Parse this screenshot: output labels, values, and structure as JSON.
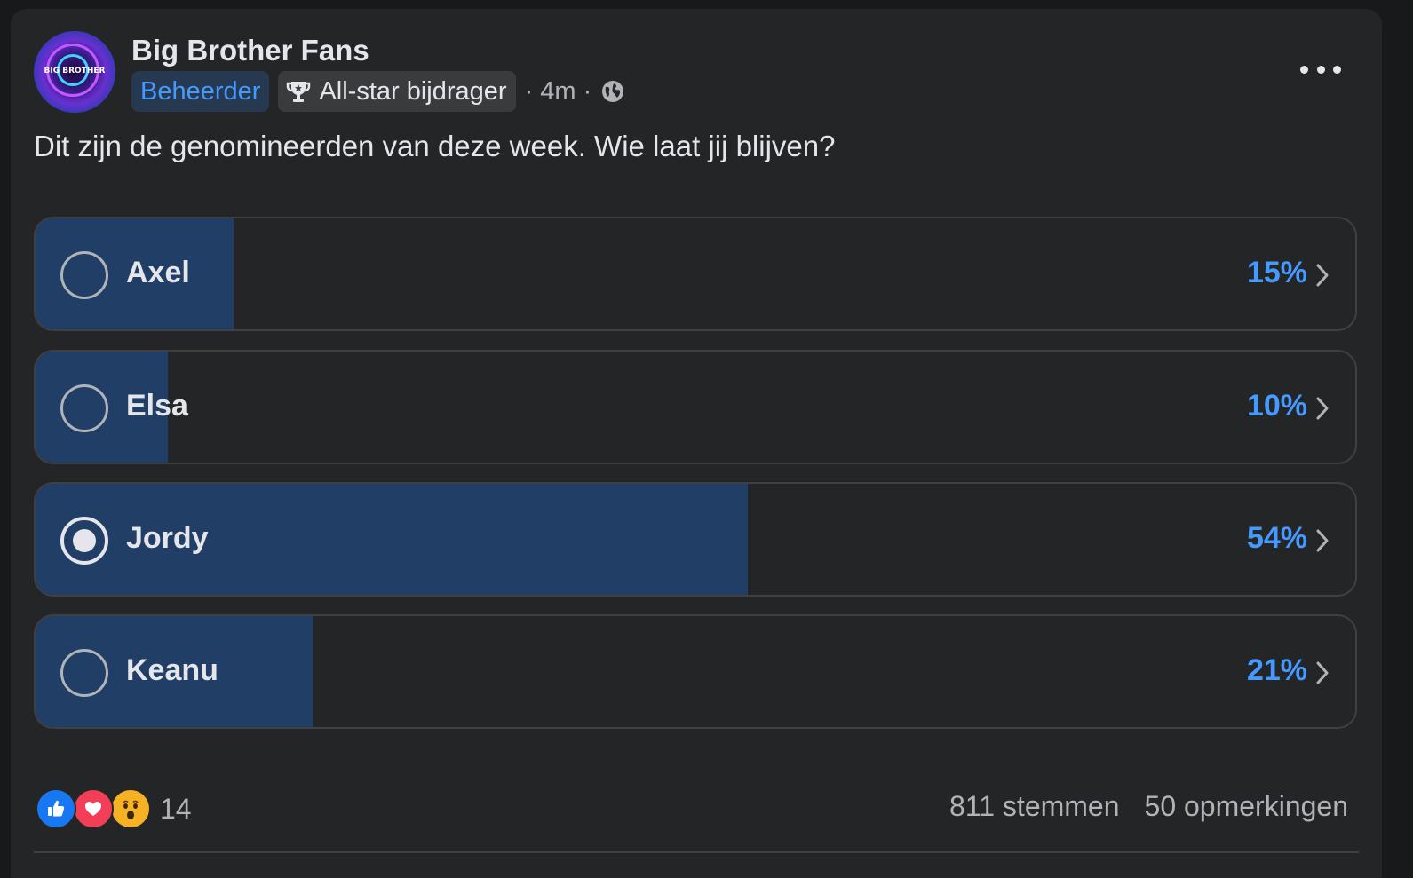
{
  "post": {
    "group_name": "Big Brother Fans",
    "avatar_logo_text": "BIG BROTHER",
    "badge_admin": "Beheerder",
    "badge_allstar": "All-star bijdrager",
    "time_text": "· 4m ·",
    "privacy_icon": "globe-icon",
    "more_icon": "more-options-icon",
    "text": "Dit zijn de genomineerden van deze week. Wie laat jij blijven?"
  },
  "poll": {
    "options": [
      {
        "label": "Axel",
        "percent_text": "15%",
        "fill_fraction": 0.15,
        "selected": false
      },
      {
        "label": "Elsa",
        "percent_text": "10%",
        "fill_fraction": 0.1,
        "selected": false
      },
      {
        "label": "Jordy",
        "percent_text": "54%",
        "fill_fraction": 0.54,
        "selected": true
      },
      {
        "label": "Keanu",
        "percent_text": "21%",
        "fill_fraction": 0.21,
        "selected": false
      }
    ]
  },
  "footer": {
    "reaction_icons": [
      "like-icon",
      "love-icon",
      "wow-icon"
    ],
    "reaction_count": "14",
    "votes_text": "811 stemmen",
    "comments_text": "50 opmerkingen"
  },
  "colors": {
    "background": "#242526",
    "fill": "#213e66",
    "accent": "#4599ff",
    "text": "#e4e6eb",
    "muted": "#b0b3b8"
  }
}
